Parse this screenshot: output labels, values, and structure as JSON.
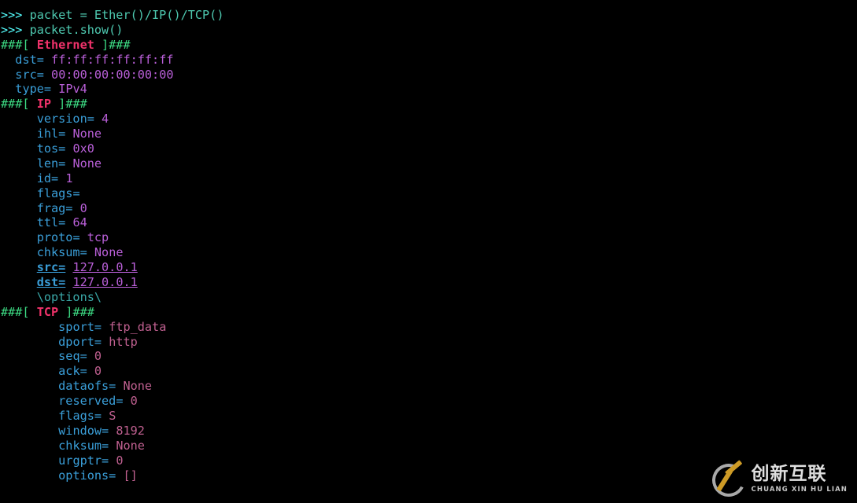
{
  "terminal": {
    "background": "#000000",
    "colors": {
      "prompt": "#55ffff",
      "command": "#4ec9b0",
      "header_hash": "#3ddc84",
      "header_name": "#f0326a",
      "field": "#3a9ed8",
      "value": "#b95fd8",
      "value_tcp": "#c06090",
      "options": "#3aa8a8"
    },
    "lines": [
      {
        "type": "prompt",
        "prompt": ">>> ",
        "text": "packet = Ether()/IP()/TCP()"
      },
      {
        "type": "prompt",
        "prompt": ">>> ",
        "text": "packet.show()"
      },
      {
        "type": "header",
        "open": "###[ ",
        "name": "Ethernet",
        "close": " ]###"
      },
      {
        "type": "field",
        "indent": "  ",
        "name": "dst",
        "sep": "= ",
        "value": "ff:ff:ff:ff:ff:ff",
        "layer": "eth"
      },
      {
        "type": "field",
        "indent": "  ",
        "name": "src",
        "sep": "= ",
        "value": "00:00:00:00:00:00",
        "layer": "eth"
      },
      {
        "type": "field",
        "indent": "  ",
        "name": "type",
        "sep": "= ",
        "value": "IPv4",
        "layer": "eth"
      },
      {
        "type": "header",
        "open": "###[ ",
        "name": "IP",
        "close": " ]###"
      },
      {
        "type": "field",
        "indent": "     ",
        "name": "version",
        "sep": "= ",
        "value": "4",
        "layer": "ip"
      },
      {
        "type": "field",
        "indent": "     ",
        "name": "ihl",
        "sep": "= ",
        "value": "None",
        "layer": "ip"
      },
      {
        "type": "field",
        "indent": "     ",
        "name": "tos",
        "sep": "= ",
        "value": "0x0",
        "layer": "ip"
      },
      {
        "type": "field",
        "indent": "     ",
        "name": "len",
        "sep": "= ",
        "value": "None",
        "layer": "ip"
      },
      {
        "type": "field",
        "indent": "     ",
        "name": "id",
        "sep": "= ",
        "value": "1",
        "layer": "ip"
      },
      {
        "type": "field",
        "indent": "     ",
        "name": "flags",
        "sep": "= ",
        "value": "",
        "layer": "ip"
      },
      {
        "type": "field",
        "indent": "     ",
        "name": "frag",
        "sep": "= ",
        "value": "0",
        "layer": "ip"
      },
      {
        "type": "field",
        "indent": "     ",
        "name": "ttl",
        "sep": "= ",
        "value": "64",
        "layer": "ip"
      },
      {
        "type": "field",
        "indent": "     ",
        "name": "proto",
        "sep": "= ",
        "value": "tcp",
        "layer": "ip"
      },
      {
        "type": "field",
        "indent": "     ",
        "name": "chksum",
        "sep": "= ",
        "value": "None",
        "layer": "ip"
      },
      {
        "type": "field",
        "indent": "     ",
        "name": "src",
        "sep": "= ",
        "value": "127.0.0.1",
        "layer": "ip",
        "underline": true
      },
      {
        "type": "field",
        "indent": "     ",
        "name": "dst",
        "sep": "= ",
        "value": "127.0.0.1",
        "layer": "ip",
        "underline": true
      },
      {
        "type": "options",
        "indent": "     ",
        "text": "\\options\\"
      },
      {
        "type": "header",
        "open": "###[ ",
        "name": "TCP",
        "close": " ]###"
      },
      {
        "type": "field",
        "indent": "        ",
        "name": "sport",
        "sep": "= ",
        "value": "ftp_data",
        "layer": "tcp"
      },
      {
        "type": "field",
        "indent": "        ",
        "name": "dport",
        "sep": "= ",
        "value": "http",
        "layer": "tcp"
      },
      {
        "type": "field",
        "indent": "        ",
        "name": "seq",
        "sep": "= ",
        "value": "0",
        "layer": "tcp"
      },
      {
        "type": "field",
        "indent": "        ",
        "name": "ack",
        "sep": "= ",
        "value": "0",
        "layer": "tcp"
      },
      {
        "type": "field",
        "indent": "        ",
        "name": "dataofs",
        "sep": "= ",
        "value": "None",
        "layer": "tcp"
      },
      {
        "type": "field",
        "indent": "        ",
        "name": "reserved",
        "sep": "= ",
        "value": "0",
        "layer": "tcp"
      },
      {
        "type": "field",
        "indent": "        ",
        "name": "flags",
        "sep": "= ",
        "value": "S",
        "layer": "tcp"
      },
      {
        "type": "field",
        "indent": "        ",
        "name": "window",
        "sep": "= ",
        "value": "8192",
        "layer": "tcp"
      },
      {
        "type": "field",
        "indent": "        ",
        "name": "chksum",
        "sep": "= ",
        "value": "None",
        "layer": "tcp"
      },
      {
        "type": "field",
        "indent": "        ",
        "name": "urgptr",
        "sep": "= ",
        "value": "0",
        "layer": "tcp"
      },
      {
        "type": "field",
        "indent": "        ",
        "name": "options",
        "sep": "= ",
        "value": "[]",
        "layer": "tcp"
      }
    ]
  },
  "watermark": {
    "logo_icon": "c-x-logo-icon",
    "chinese": "创新互联",
    "pinyin": "CHUANG XIN HU LIAN",
    "ring_color": "#b8b8b8",
    "x_color": "#e0a92a"
  }
}
